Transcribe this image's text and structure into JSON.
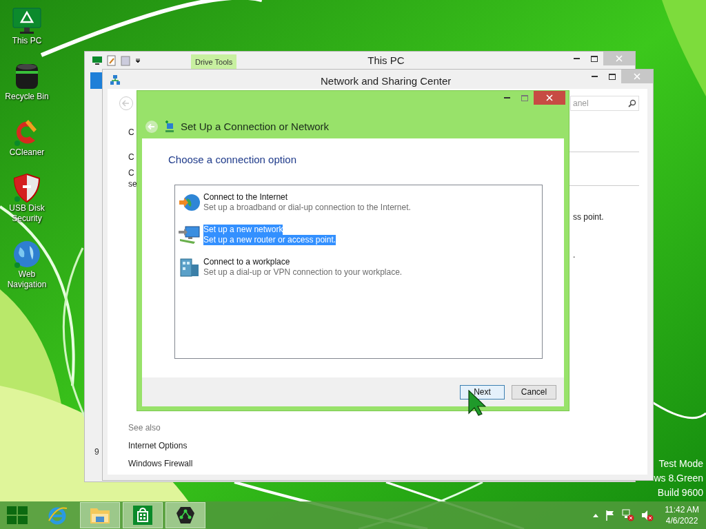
{
  "desktop_icons": [
    {
      "label": "This PC",
      "kind": "computer"
    },
    {
      "label": "Recycle Bin",
      "kind": "bin"
    },
    {
      "label": "CCleaner",
      "kind": "cleaner"
    },
    {
      "label": "USB Disk Security",
      "kind": "shield"
    },
    {
      "label": "Web Navigation",
      "kind": "globe"
    }
  ],
  "this_pc_window": {
    "title": "This PC",
    "ribbon_tab": "Drive Tools",
    "status_text": "9"
  },
  "network_center_window": {
    "title": "Network and Sharing Center",
    "search_text": "anel",
    "left_texts": [
      "C",
      "C",
      "C",
      "se"
    ],
    "right_texts": [
      "ss point.",
      "."
    ],
    "see_also": {
      "heading": "See also",
      "links": [
        "Internet Options",
        "Windows Firewall"
      ]
    }
  },
  "dialog": {
    "title": "Set Up a Connection or Network",
    "heading": "Choose a connection option",
    "options": [
      {
        "kind": "internet",
        "title": "Connect to the Internet",
        "description": "Set up a broadband or dial-up connection to the Internet.",
        "selected": false
      },
      {
        "kind": "network",
        "title": "Set up a new network",
        "description": "Set up a new router or access point.",
        "selected": true
      },
      {
        "kind": "workplace",
        "title": "Connect to a workplace",
        "description": "Set up a dial-up or VPN connection to your workplace.",
        "selected": false
      }
    ],
    "buttons": [
      {
        "label": "Next",
        "default": true
      },
      {
        "label": "Cancel",
        "default": false
      }
    ]
  },
  "test_mode_lines": [
    "Test Mode",
    "ws 8.Green",
    "Build 9600"
  ],
  "taskbar": {
    "items": [
      {
        "kind": "browser",
        "running": false
      },
      {
        "kind": "folder",
        "running": true
      },
      {
        "kind": "store",
        "running": true
      },
      {
        "kind": "app",
        "running": true
      }
    ],
    "time": "11:42 AM",
    "date": "4/6/2022"
  }
}
